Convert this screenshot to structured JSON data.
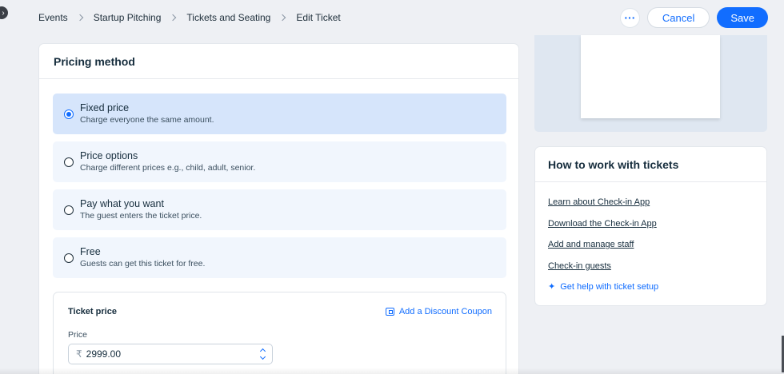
{
  "sidebar_toggle": {
    "icon": "chevron-right-icon",
    "glyph": "›"
  },
  "breadcrumb": [
    "Events",
    "Startup Pitching",
    "Tickets and Seating",
    "Edit Ticket"
  ],
  "header_actions": {
    "more_glyph": "···",
    "cancel_label": "Cancel",
    "save_label": "Save"
  },
  "pricing": {
    "title": "Pricing method",
    "selected": "Fixed price",
    "options": [
      {
        "title": "Fixed price",
        "description": "Charge everyone the same amount."
      },
      {
        "title": "Price options",
        "description": "Charge different prices e.g., child, adult, senior."
      },
      {
        "title": "Pay what you want",
        "description": "The guest enters the ticket price."
      },
      {
        "title": "Free",
        "description": "Guests can get this ticket for free."
      }
    ]
  },
  "ticket_price": {
    "title": "Ticket price",
    "coupon_link": "Add a Discount Coupon",
    "price_label": "Price",
    "currency_symbol": "₹",
    "price_value": "2999.00"
  },
  "help": {
    "title": "How to work with tickets",
    "links": [
      "Learn about Check-in App",
      "Download the Check-in App",
      "Add and manage staff",
      "Check-in guests"
    ],
    "ai_link": "Get help with ticket setup"
  },
  "colors": {
    "accent": "#116dff",
    "selected_bg": "#d6e5fb",
    "option_bg": "#f1f6fd",
    "page_bg": "#eef0f4"
  }
}
